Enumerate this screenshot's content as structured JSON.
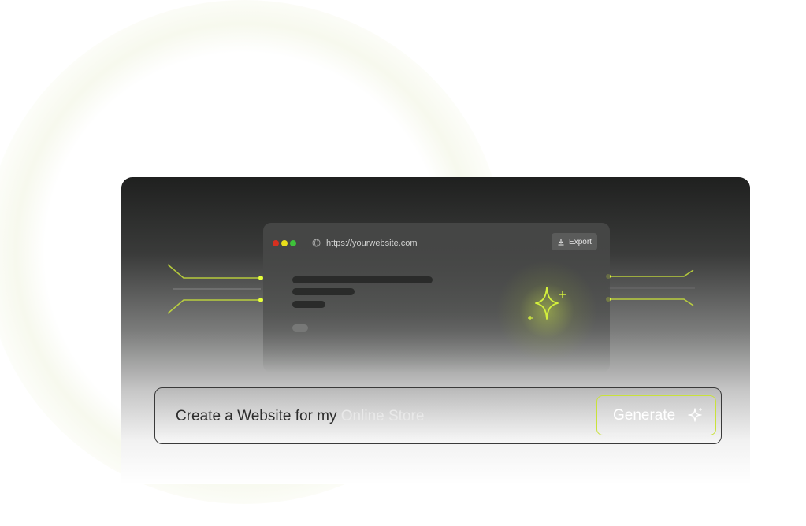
{
  "browser": {
    "url": "https://yourwebsite.com",
    "export_label": "Export",
    "window_controls": [
      "close-dot",
      "minimize-dot",
      "maximize-dot"
    ],
    "icons": [
      "globe-icon",
      "download-icon",
      "sparkle-icon"
    ]
  },
  "prompt": {
    "text_main": "Create a Website for my ",
    "text_highlight": "Online Store",
    "button_label": "Generate",
    "button_icon": "sparkle-icon"
  },
  "colors": {
    "accent": "#d4f03c",
    "panel_dark": "#1f201f",
    "close": "#d7301f",
    "minimize": "#e9df1b",
    "maximize": "#3ec23a"
  }
}
